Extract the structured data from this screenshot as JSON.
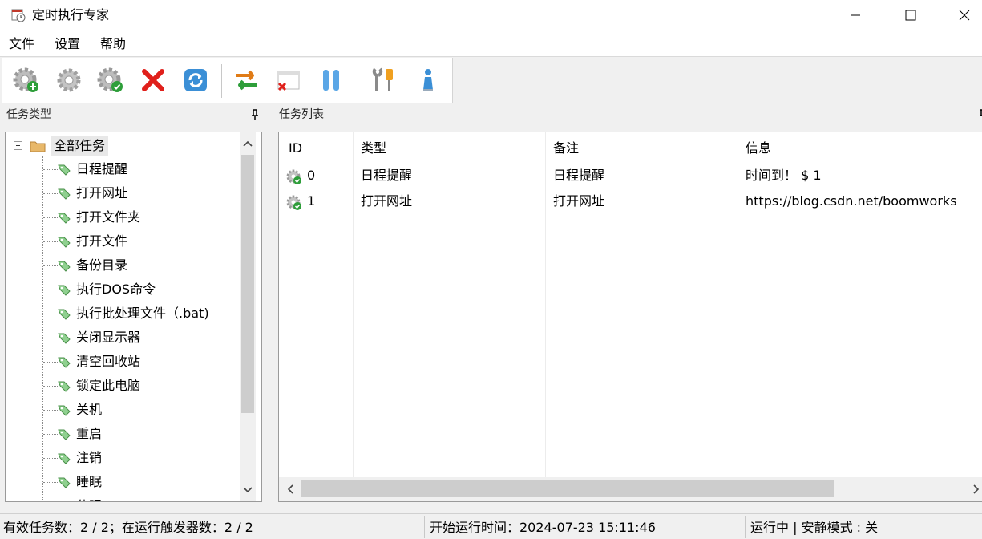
{
  "window": {
    "title": "定时执行专家"
  },
  "menu": {
    "items": [
      "文件",
      "设置",
      "帮助"
    ]
  },
  "panels": {
    "left_title": "任务类型",
    "right_title": "任务列表"
  },
  "tree": {
    "root": "全部任务",
    "items": [
      "日程提醒",
      "打开网址",
      "打开文件夹",
      "打开文件",
      "备份目录",
      "执行DOS命令",
      "执行批处理文件（.bat)",
      "关闭显示器",
      "清空回收站",
      "锁定此电脑",
      "关机",
      "重启",
      "注销",
      "睡眠",
      "休眠"
    ]
  },
  "task_list": {
    "columns": [
      "ID",
      "类型",
      "备注",
      "信息"
    ],
    "rows": [
      {
        "id": "0",
        "type": "日程提醒",
        "note": "日程提醒",
        "info": "时间到！ $ 1"
      },
      {
        "id": "1",
        "type": "打开网址",
        "note": "打开网址",
        "info": "https://blog.csdn.net/boomworks"
      }
    ]
  },
  "status": {
    "tasks": "有效任务数：2 / 2；在运行触发器数：2 / 2",
    "start_time": "开始运行时间：2024-07-23 15:11:46",
    "state": "运行中 | 安静模式 : 关"
  },
  "icons": {
    "toolbar": [
      "add-gear-icon",
      "gear-icon",
      "enable-gear-icon",
      "delete-icon",
      "refresh-icon",
      "switch-icon",
      "close-window-icon",
      "pause-icon",
      "tools-icon",
      "info-icon"
    ]
  },
  "colors": {
    "accent_green": "#2e9e3a",
    "delete_red": "#e0201b",
    "refresh_blue": "#3b8fd6",
    "pause_blue": "#5aa6e6"
  }
}
